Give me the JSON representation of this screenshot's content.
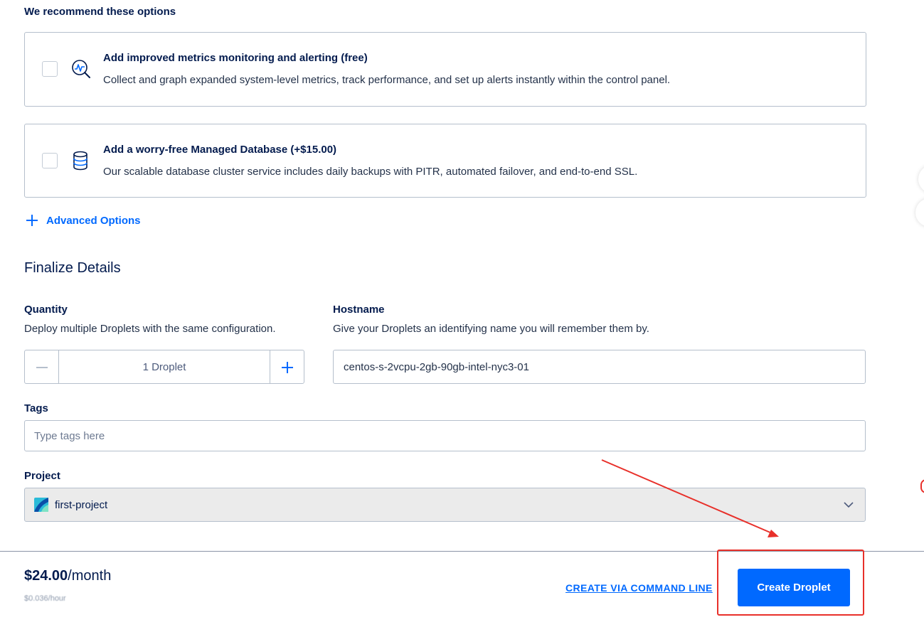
{
  "recommend": {
    "heading": "We recommend these options",
    "options": [
      {
        "title": "Add improved metrics monitoring and alerting (free)",
        "description": "Collect and graph expanded system-level metrics, track performance, and set up alerts instantly within the control panel.",
        "icon": "metrics-chart-icon",
        "checked": false
      },
      {
        "title": "Add a worry-free Managed Database (+$15.00)",
        "description": "Our scalable database cluster service includes daily backups with PITR, automated failover, and end-to-end SSL.",
        "icon": "database-icon",
        "checked": false
      }
    ]
  },
  "advanced_options": {
    "label": "Advanced Options",
    "icon": "plus-icon"
  },
  "finalize": {
    "title": "Finalize Details",
    "quantity": {
      "label": "Quantity",
      "help": "Deploy multiple Droplets with the same configuration.",
      "value": "1  Droplet"
    },
    "hostname": {
      "label": "Hostname",
      "help": "Give your Droplets an identifying name you will remember them by.",
      "value": "centos-s-2vcpu-2gb-90gb-intel-nyc3-01"
    },
    "tags": {
      "label": "Tags",
      "placeholder": "Type tags here"
    },
    "project": {
      "label": "Project",
      "value": "first-project"
    }
  },
  "footer": {
    "price": "$24.00",
    "price_unit": "/month",
    "price_sub": "$0.036/hour",
    "cli_link": "CREATE VIA COMMAND LINE",
    "create_button": "Create Droplet"
  },
  "colors": {
    "accent": "#0069ff",
    "annotation": "#e8302a",
    "text": "#031b4e"
  }
}
